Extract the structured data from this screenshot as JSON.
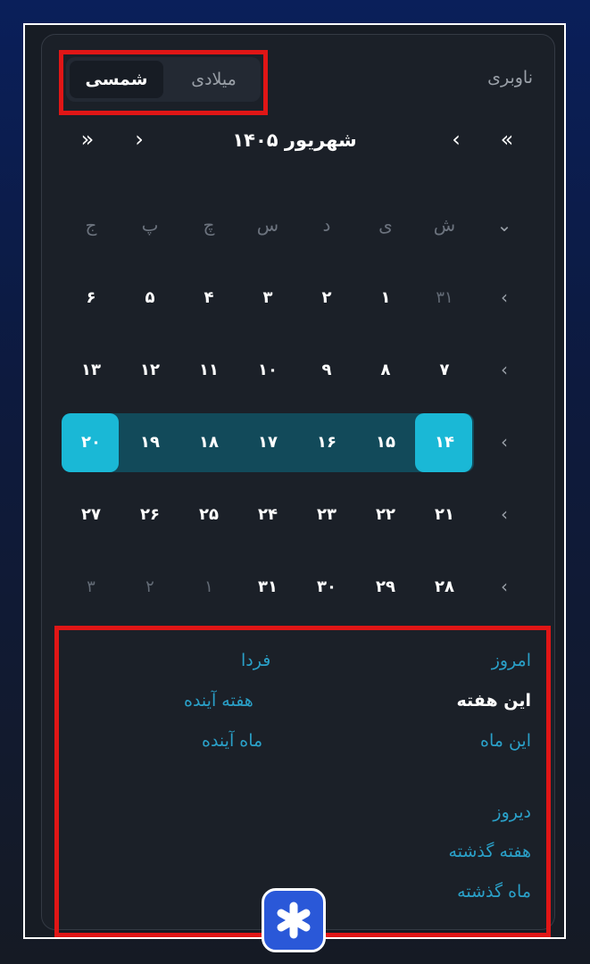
{
  "nav_label": "ناوبری",
  "toggle": {
    "gregorian": "میلادی",
    "jalali": "شمسی"
  },
  "month_title": "شهریور ۱۴۰۵",
  "nav": {
    "prev_year": "»",
    "prev_month": "›",
    "next_month": "‹",
    "next_year": "«"
  },
  "weekday_chevron": "⌄",
  "weekdays": [
    "ش",
    "ی",
    "د",
    "س",
    "چ",
    "پ",
    "ج"
  ],
  "row_chevron": "‹",
  "weeks": [
    [
      "۳۱",
      "۱",
      "۲",
      "۳",
      "۴",
      "۵",
      "۶"
    ],
    [
      "۷",
      "۸",
      "۹",
      "۱۰",
      "۱۱",
      "۱۲",
      "۱۳"
    ],
    [
      "۱۴",
      "۱۵",
      "۱۶",
      "۱۷",
      "۱۸",
      "۱۹",
      "۲۰"
    ],
    [
      "۲۱",
      "۲۲",
      "۲۳",
      "۲۴",
      "۲۵",
      "۲۶",
      "۲۷"
    ],
    [
      "۲۸",
      "۲۹",
      "۳۰",
      "۳۱",
      "۱",
      "۲",
      "۳"
    ]
  ],
  "quick": {
    "today": "امروز",
    "tomorrow": "فردا",
    "this_week": "این هفته",
    "next_week": "هفته آینده",
    "this_month": "این ماه",
    "next_month": "ماه آینده",
    "yesterday": "دیروز",
    "last_week": "هفته گذشته",
    "last_month": "ماه گذشته"
  },
  "colors": {
    "accent": "#1ab8d6",
    "week_band": "#124a5a",
    "highlight_border": "#e01616",
    "link": "#2aa0c8"
  }
}
